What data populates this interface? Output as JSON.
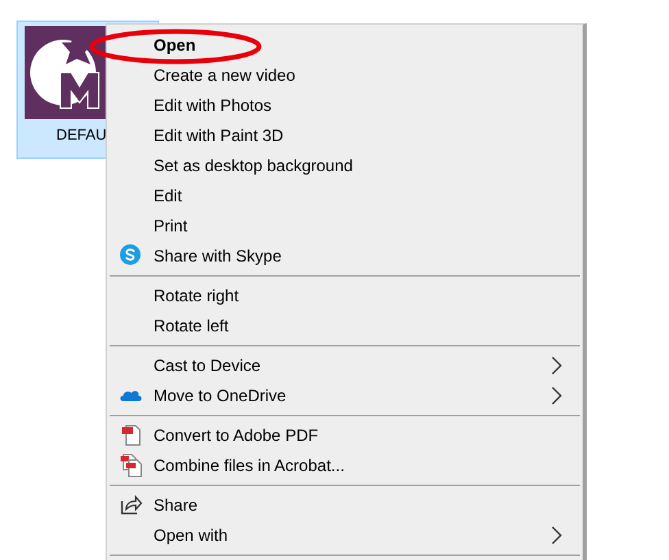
{
  "desktop_icon": {
    "label": "DEFAU",
    "selected": true
  },
  "context_menu": {
    "groups": [
      {
        "items": [
          {
            "label": "Open",
            "default": true,
            "kind": "plain",
            "submenu": false
          },
          {
            "label": "Create a new video",
            "default": false,
            "kind": "plain",
            "submenu": false
          },
          {
            "label": "Edit with Photos",
            "default": false,
            "kind": "plain",
            "submenu": false
          },
          {
            "label": "Edit with Paint 3D",
            "default": false,
            "kind": "plain",
            "submenu": false
          },
          {
            "label": "Set as desktop background",
            "default": false,
            "kind": "plain",
            "submenu": false
          },
          {
            "label": "Edit",
            "default": false,
            "kind": "plain",
            "submenu": false
          },
          {
            "label": "Print",
            "default": false,
            "kind": "plain",
            "submenu": false
          },
          {
            "label": "Share with Skype",
            "default": false,
            "kind": "skype",
            "submenu": false
          }
        ]
      },
      {
        "items": [
          {
            "label": "Rotate right",
            "default": false,
            "kind": "plain",
            "submenu": false
          },
          {
            "label": "Rotate left",
            "default": false,
            "kind": "plain",
            "submenu": false
          }
        ]
      },
      {
        "items": [
          {
            "label": "Cast to Device",
            "default": false,
            "kind": "plain",
            "submenu": true
          },
          {
            "label": "Move to OneDrive",
            "default": false,
            "kind": "cloud",
            "submenu": true
          }
        ]
      },
      {
        "items": [
          {
            "label": "Convert to Adobe PDF",
            "default": false,
            "kind": "pdf",
            "submenu": false
          },
          {
            "label": "Combine files in Acrobat...",
            "default": false,
            "kind": "pdfs",
            "submenu": false
          }
        ]
      },
      {
        "items": [
          {
            "label": "Share",
            "default": false,
            "kind": "share",
            "submenu": false
          },
          {
            "label": "Open with",
            "default": false,
            "kind": "plain",
            "submenu": true
          }
        ]
      }
    ]
  }
}
